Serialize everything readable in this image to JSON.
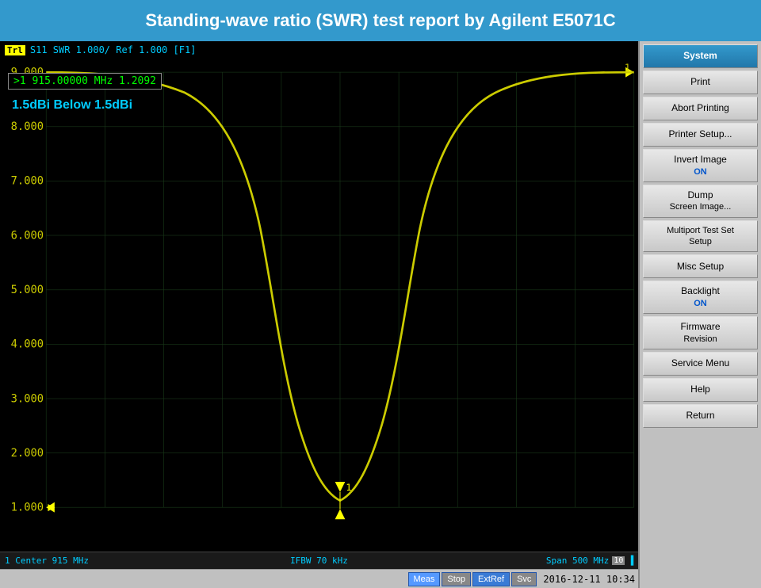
{
  "header": {
    "title": "Standing-wave ratio (SWR) test report by Agilent E5071C"
  },
  "chart": {
    "trace_label": "Trl",
    "trace_info": "S11  SWR 1.000/ Ref 1.000 [F1]",
    "marker_info": ">1   915.00000 MHz   1.2092",
    "annotation_line1": "1.5dBi Below 1.5dBi",
    "y_labels": [
      {
        "value": "9.000",
        "pct": 3
      },
      {
        "value": "8.000",
        "pct": 14
      },
      {
        "value": "7.000",
        "pct": 25
      },
      {
        "value": "6.000",
        "pct": 36
      },
      {
        "value": "5.000",
        "pct": 47
      },
      {
        "value": "4.000",
        "pct": 58
      },
      {
        "value": "3.000",
        "pct": 69
      },
      {
        "value": "2.000",
        "pct": 80
      },
      {
        "value": "1.000",
        "pct": 91
      }
    ],
    "bottom": {
      "center": "1  Center 915 MHz",
      "ifbw": "IFBW 70 kHz",
      "span": "Span 500 MHz"
    }
  },
  "right_panel": {
    "buttons": [
      {
        "label": "System",
        "active": true,
        "id": "system"
      },
      {
        "label": "Print",
        "active": false,
        "id": "print"
      },
      {
        "label": "Abort Printing",
        "active": false,
        "id": "abort-printing"
      },
      {
        "label": "Printer Setup...",
        "active": false,
        "id": "printer-setup"
      },
      {
        "label": "Invert Image\nON",
        "active": false,
        "id": "invert-image",
        "sub": "ON"
      },
      {
        "label": "Dump\nScreen Image...",
        "active": false,
        "id": "dump-screen",
        "sub": "Screen Image..."
      },
      {
        "label": "Multiport Test Set\nSetup",
        "active": false,
        "id": "multiport-setup"
      },
      {
        "label": "Misc Setup",
        "active": false,
        "id": "misc-setup"
      },
      {
        "label": "Backlight\nON",
        "active": false,
        "id": "backlight",
        "sub": "ON"
      },
      {
        "label": "Firmware\nRevision",
        "active": false,
        "id": "firmware"
      },
      {
        "label": "Service Menu",
        "active": false,
        "id": "service-menu"
      },
      {
        "label": "Help",
        "active": false,
        "id": "help"
      },
      {
        "label": "Return",
        "active": false,
        "id": "return"
      }
    ]
  },
  "status_bar": {
    "meas_label": "Meas",
    "stop_label": "Stop",
    "extref_label": "ExtRef",
    "svc_label": "Svc",
    "datetime": "2016-12-11 10:34"
  }
}
